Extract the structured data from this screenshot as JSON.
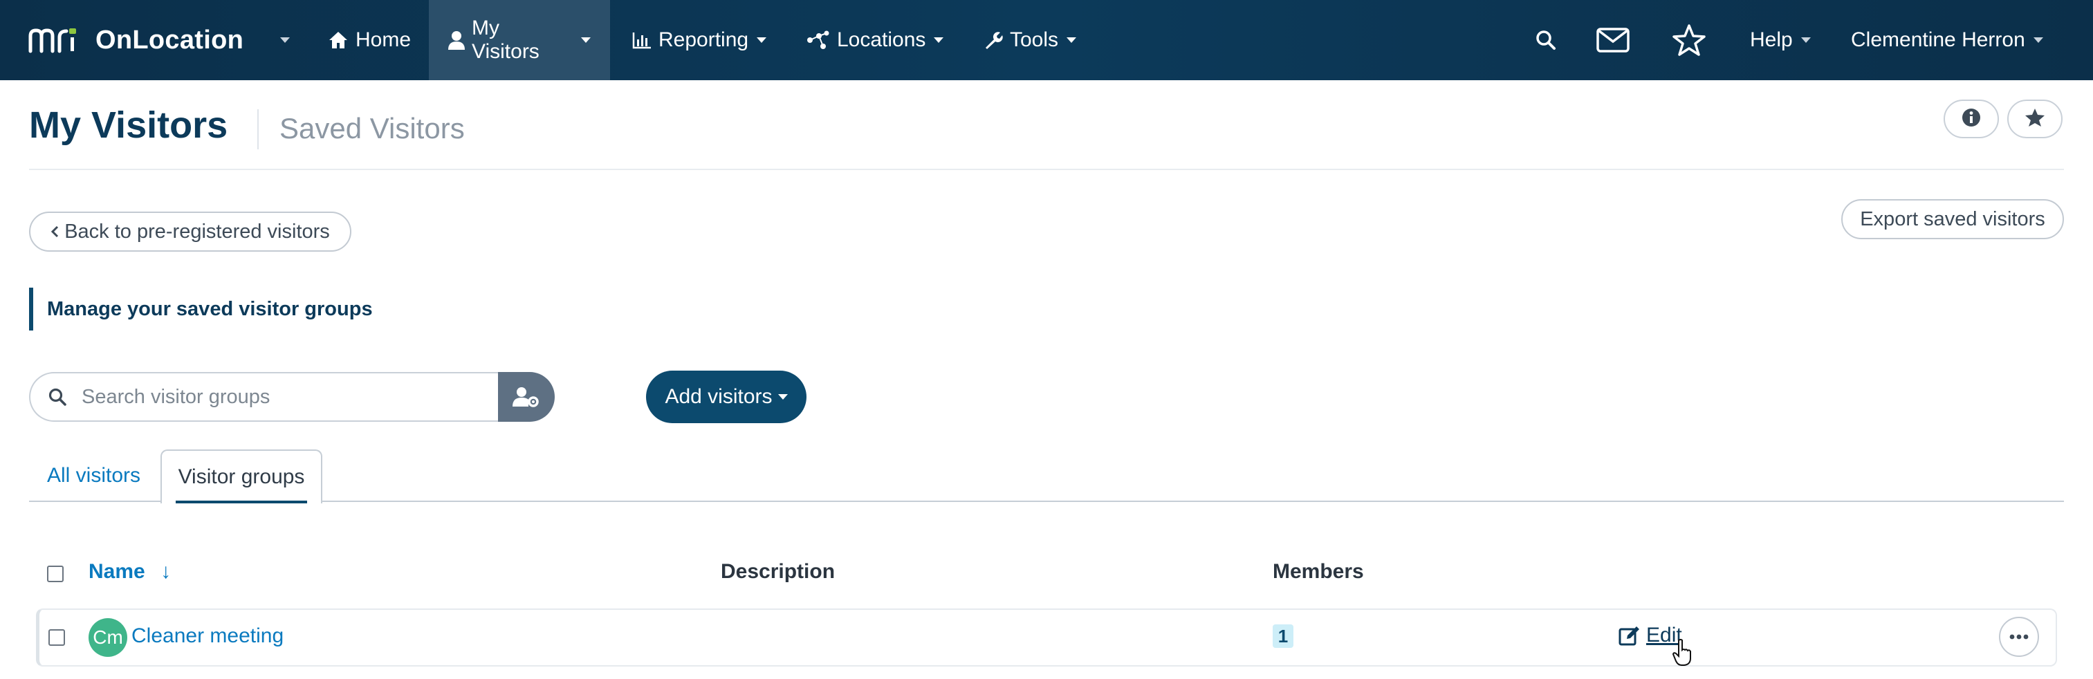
{
  "brand": {
    "logo_text": "mri",
    "app_name": "OnLocation"
  },
  "nav": {
    "items": [
      {
        "label": "Home",
        "icon": "home-icon"
      },
      {
        "label": "My Visitors",
        "icon": "user-icon"
      },
      {
        "label": "Reporting",
        "icon": "bar-chart-icon"
      },
      {
        "label": "Locations",
        "icon": "network-icon"
      },
      {
        "label": "Tools",
        "icon": "wrench-icon"
      }
    ],
    "help_label": "Help",
    "user_name": "Clementine Herron"
  },
  "header": {
    "title": "My Visitors",
    "subtitle": "Saved Visitors"
  },
  "actions": {
    "back_label": "Back to pre-registered visitors",
    "export_label": "Export saved visitors",
    "add_label": "Add visitors"
  },
  "banner": {
    "text": "Manage your saved visitor groups"
  },
  "search": {
    "placeholder": "Search visitor groups"
  },
  "tabs": [
    {
      "label": "All visitors",
      "active": false
    },
    {
      "label": "Visitor groups",
      "active": true
    }
  ],
  "table": {
    "columns": {
      "name": "Name",
      "description": "Description",
      "members": "Members"
    },
    "sort_indicator": "↓",
    "rows": [
      {
        "initials": "Cm",
        "name": "Cleaner meeting",
        "description": "",
        "members": "1",
        "edit_label": "Edit"
      }
    ]
  },
  "colors": {
    "nav_bg": "#0b2f4a",
    "nav_active": "#2b4f6a",
    "primary": "#0c4a6e",
    "link": "#0a7abf",
    "avatar": "#3fb58a",
    "logo_accent": "#8dc63f"
  }
}
